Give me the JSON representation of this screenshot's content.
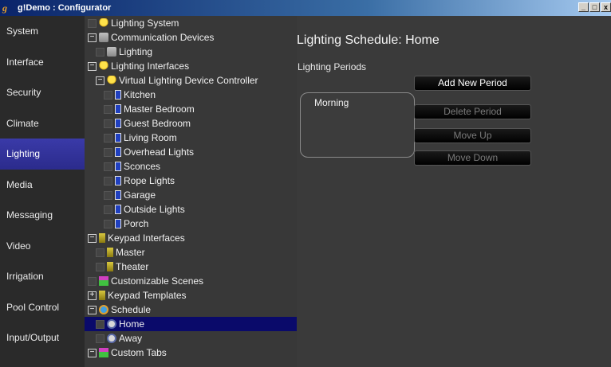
{
  "window": {
    "title": "g!Demo : Configurator",
    "min": "_",
    "max": "□",
    "close": "x"
  },
  "nav": [
    "System",
    "Interface",
    "Security",
    "Climate",
    "Lighting",
    "Media",
    "Messaging",
    "Video",
    "Irrigation",
    "Pool Control",
    "Input/Output"
  ],
  "nav_active": "Lighting",
  "tree": [
    {
      "label": "Lighting System",
      "indent": 0,
      "box": "blank",
      "icon": "bulb"
    },
    {
      "label": "Communication Devices",
      "indent": 0,
      "box": "minus",
      "icon": "comm"
    },
    {
      "label": "Lighting",
      "indent": 1,
      "box": "blank",
      "icon": "comm"
    },
    {
      "label": "Lighting Interfaces",
      "indent": 0,
      "box": "minus",
      "icon": "bulb"
    },
    {
      "label": "Virtual Lighting Device Controller",
      "indent": 1,
      "box": "minus",
      "icon": "bulb"
    },
    {
      "label": "Kitchen",
      "indent": 2,
      "box": "blank",
      "icon": "bookmark"
    },
    {
      "label": "Master Bedroom",
      "indent": 2,
      "box": "blank",
      "icon": "bookmark"
    },
    {
      "label": "Guest Bedroom",
      "indent": 2,
      "box": "blank",
      "icon": "bookmark"
    },
    {
      "label": "Living Room",
      "indent": 2,
      "box": "blank",
      "icon": "bookmark"
    },
    {
      "label": "Overhead Lights",
      "indent": 2,
      "box": "blank",
      "icon": "bookmark"
    },
    {
      "label": "Sconces",
      "indent": 2,
      "box": "blank",
      "icon": "bookmark"
    },
    {
      "label": "Rope Lights",
      "indent": 2,
      "box": "blank",
      "icon": "bookmark"
    },
    {
      "label": "Garage",
      "indent": 2,
      "box": "blank",
      "icon": "bookmark"
    },
    {
      "label": "Outside Lights",
      "indent": 2,
      "box": "blank",
      "icon": "bookmark"
    },
    {
      "label": "Porch",
      "indent": 2,
      "box": "blank",
      "icon": "bookmark"
    },
    {
      "label": "Keypad Interfaces",
      "indent": 0,
      "box": "minus",
      "icon": "keypad"
    },
    {
      "label": "Master",
      "indent": 1,
      "box": "blank",
      "icon": "keypad"
    },
    {
      "label": "Theater",
      "indent": 1,
      "box": "blank",
      "icon": "keypad"
    },
    {
      "label": "Customizable Scenes",
      "indent": 0,
      "box": "blank",
      "icon": "scene"
    },
    {
      "label": "Keypad Templates",
      "indent": 0,
      "box": "plus",
      "icon": "keypad"
    },
    {
      "label": "Schedule",
      "indent": 0,
      "box": "minus",
      "icon": "sched"
    },
    {
      "label": "Home",
      "indent": 1,
      "box": "blank",
      "icon": "clock",
      "selected": true
    },
    {
      "label": "Away",
      "indent": 1,
      "box": "blank",
      "icon": "clock"
    },
    {
      "label": "Custom Tabs",
      "indent": 0,
      "box": "minus",
      "icon": "scene"
    }
  ],
  "content": {
    "title": "Lighting Schedule: Home",
    "subtitle": "Lighting Periods",
    "periods": [
      "Morning"
    ],
    "buttons": {
      "add": "Add New Period",
      "delete": "Delete Period",
      "move_up": "Move Up",
      "move_down": "Move Down"
    }
  }
}
